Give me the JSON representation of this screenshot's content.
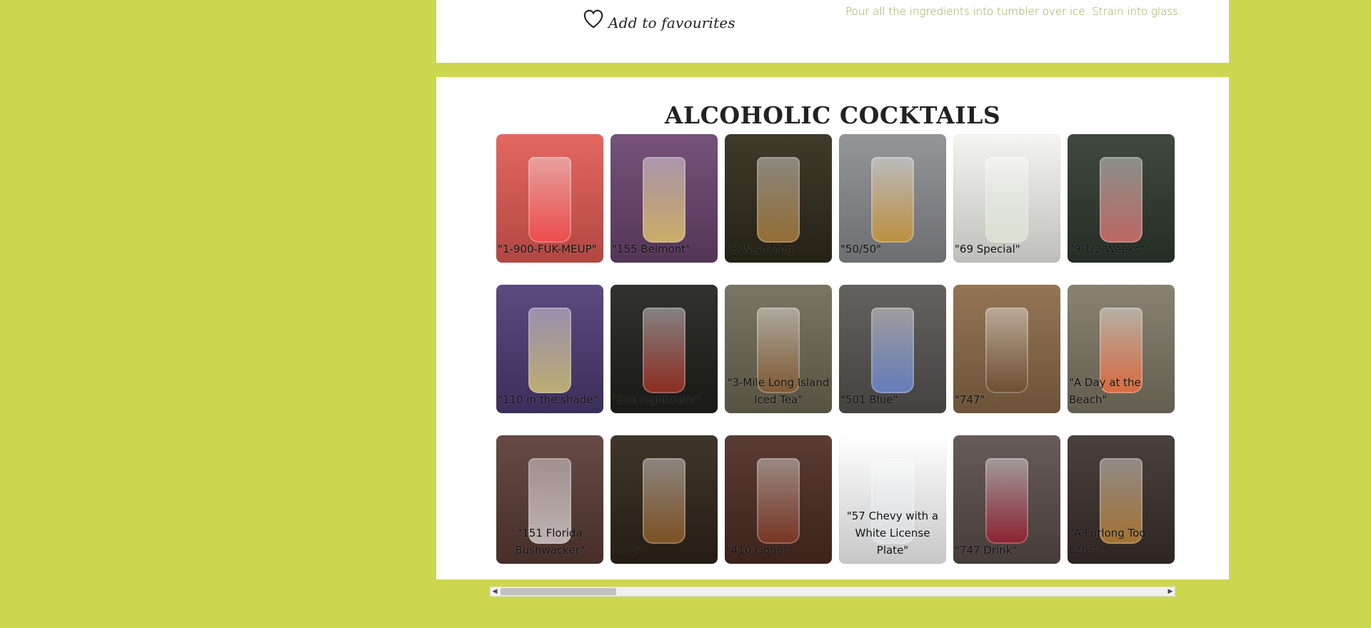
{
  "favourites": {
    "label": "Add to favourites"
  },
  "instructions": {
    "text": "Pour all the ingredients into tumbler over ice. Strain into glass."
  },
  "section": {
    "title": "ALCOHOLIC COCKTAILS"
  },
  "tiles": [
    {
      "label": "\"1-900-FUK-MEUP\"",
      "bg": "#e25b54",
      "glass": "#ff4d4f"
    },
    {
      "label": "\"155 Belmont\"",
      "bg": "#6b446f",
      "glass": "#f3d46a"
    },
    {
      "label": "\"3 Wise Men\"",
      "bg": "#2f2a1a",
      "glass": "#b8863e"
    },
    {
      "label": "\"50/50\"",
      "bg": "#8b8d91",
      "glass": "#d79a2e"
    },
    {
      "label": "\"69 Special\"",
      "bg": "#f4f4f0",
      "glass": "#dfe6d5"
    },
    {
      "label": "\"9 1/2 Weeks\"",
      "bg": "#2f3a2f",
      "glass": "#f07a77"
    },
    {
      "label": "\"110 in the shade\"",
      "bg": "#4d3b74",
      "glass": "#e8d779"
    },
    {
      "label": "\"24k nightmare\"",
      "bg": "#20201f",
      "glass": "#b43222"
    },
    {
      "label": "\"3-Mile Long Island Iced Tea\"",
      "bg": "#6f6a56",
      "glass": "#8c5a2b"
    },
    {
      "label": "\"501 Blue\"",
      "bg": "#575452",
      "glass": "#6f8fe4"
    },
    {
      "label": "\"747\"",
      "bg": "#8b6a47",
      "glass": "#6d4b2f"
    },
    {
      "label": "\"A Day at the Beach\"",
      "bg": "#7f7866",
      "glass": "#ff6d36"
    },
    {
      "label": "\"151 Florida Bushwacker\"",
      "bg": "#5a3b35",
      "glass": "#e6dfe1"
    },
    {
      "label": "\"252\"",
      "bg": "#2f2519",
      "glass": "#9a6128"
    },
    {
      "label": "\"410 Gone\"",
      "bg": "#4c2c23",
      "glass": "#8b3b24"
    },
    {
      "label": "\"57 Chevy with a White License Plate\"",
      "bg": "#ffffff",
      "glass": "#dfe4e8"
    },
    {
      "label": "\"747 Drink\"",
      "bg": "#5a4d4a",
      "glass": "#a2182f"
    },
    {
      "label": "\"A Furlong Too Late\"",
      "bg": "#3b302c",
      "glass": "#c98b34"
    }
  ],
  "icons": {
    "heart": "heart-icon",
    "scroll_left": "scroll-left-icon",
    "scroll_right": "scroll-right-icon"
  },
  "colors": {
    "page_background": "#cdd74f",
    "card_background": "#ffffff",
    "accent_text": "#9aa54c"
  }
}
